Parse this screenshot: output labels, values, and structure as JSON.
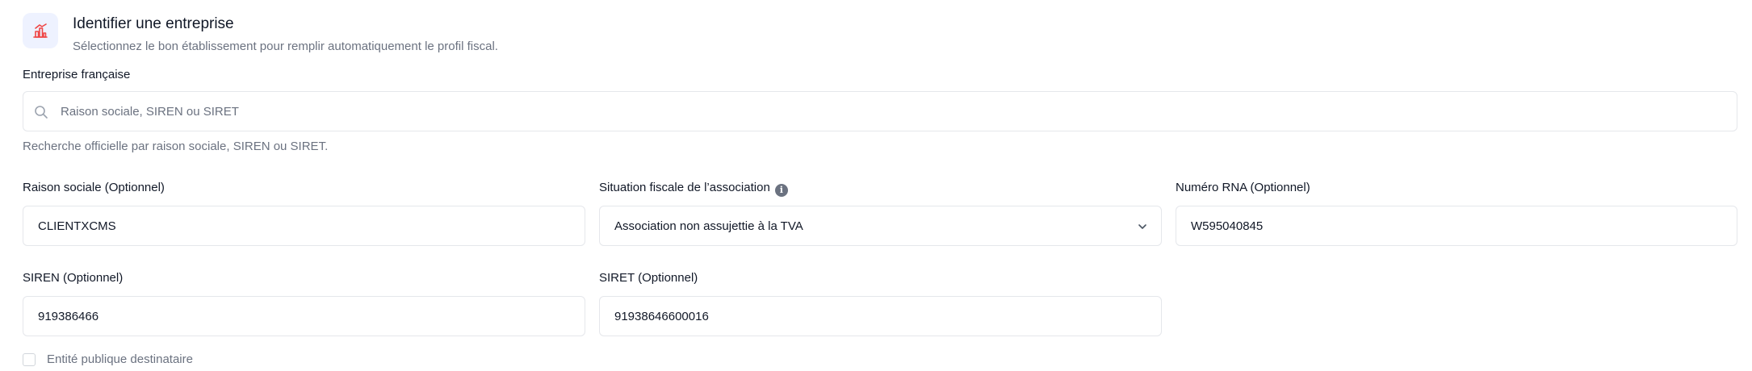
{
  "header": {
    "title": "Identifier une entreprise",
    "subtitle": "Sélectionnez le bon établissement pour remplir automatiquement le profil fiscal."
  },
  "search": {
    "label": "Entreprise française",
    "placeholder": "Raison sociale, SIREN ou SIRET",
    "helper": "Recherche officielle par raison sociale, SIREN ou SIRET."
  },
  "fields": {
    "raison_sociale": {
      "label": "Raison sociale (Optionnel)",
      "value": "CLIENTXCMS"
    },
    "situation_fiscale": {
      "label": "Situation fiscale de l’association",
      "value": "Association non assujettie à la TVA"
    },
    "rna": {
      "label": "Numéro RNA (Optionnel)",
      "value": "W595040845"
    },
    "siren": {
      "label": "SIREN (Optionnel)",
      "value": "919386466"
    },
    "siret": {
      "label": "SIRET (Optionnel)",
      "value": "91938646600016"
    }
  },
  "checkbox": {
    "label": "Entité publique destinataire",
    "checked": false
  },
  "icons": {
    "header": "building-chart-icon",
    "search": "search-icon",
    "info": "info-icon",
    "select": "chevron-down-icon"
  },
  "colors": {
    "accent_icon": "#ef4444",
    "icon_bg": "#eef2ff",
    "border": "#e5e7eb",
    "muted_text": "#6b7280"
  }
}
